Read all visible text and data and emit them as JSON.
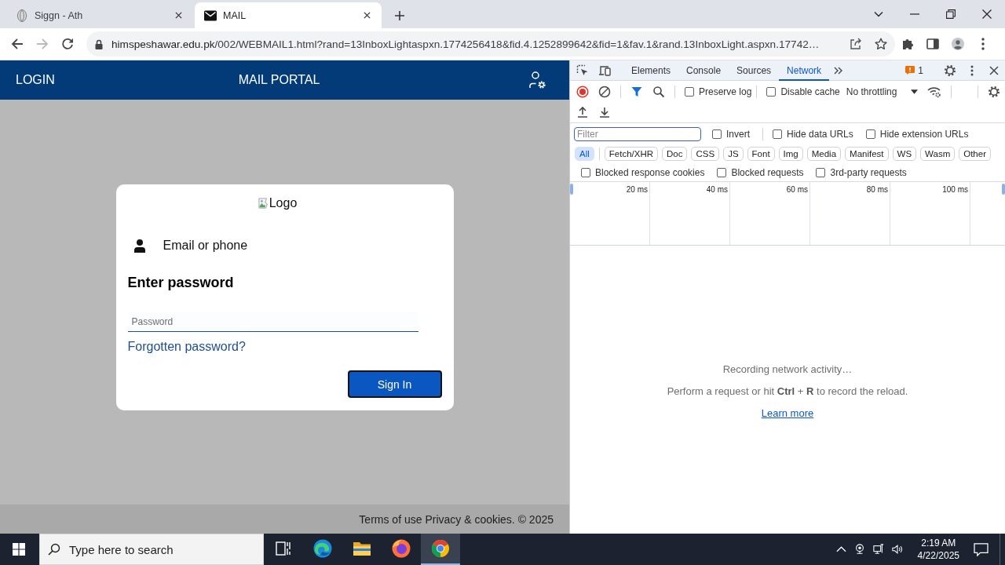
{
  "browser": {
    "tabs": [
      {
        "title": "Siggn - Ath",
        "kind": "globe",
        "selected": false
      },
      {
        "title": "MAIL",
        "kind": "mail",
        "selected": true
      }
    ],
    "nav_buttons": [
      {
        "kind": "back",
        "disabled": false
      },
      {
        "kind": "forward",
        "disabled": true
      },
      {
        "kind": "reload",
        "disabled": false
      }
    ],
    "address": {
      "host": "himspeshawar.edu.pk",
      "path": "/002/WEBMAIL1.html?rand=13InboxLightaspxn.1774256418&fid.4.1252899642&fid=1&fav.1&rand.13InboxLight.aspxn.17742…"
    }
  },
  "page": {
    "header": {
      "left": "LOGIN",
      "title": "MAIL PORTAL"
    },
    "card": {
      "logo_alt": "Logo",
      "account": "Email or phone",
      "heading": "Enter password",
      "password": {
        "placeholder": "Password"
      },
      "forgot_link": "Forgotten password?",
      "submit": "Sign In"
    },
    "footer": "Terms of use Privacy & cookies. © 2025"
  },
  "devtools": {
    "tabs": [
      {
        "label": "Elements",
        "selected": false
      },
      {
        "label": "Console",
        "selected": false
      },
      {
        "label": "Sources",
        "selected": false
      },
      {
        "label": "Network",
        "selected": true
      }
    ],
    "issues_count": "1",
    "recording": true,
    "toolbar_checks": [
      {
        "label": "Preserve log",
        "checked": false
      },
      {
        "label": "Disable cache",
        "checked": false
      }
    ],
    "throttling": "No throttling",
    "filter": {
      "placeholder": "Filter",
      "focused": true
    },
    "filter_checks": [
      {
        "label": "Invert",
        "checked": false
      },
      {
        "label": "Hide data URLs",
        "checked": false
      },
      {
        "label": "Hide extension URLs",
        "checked": false
      }
    ],
    "types": [
      {
        "label": "All",
        "selected": true
      },
      {
        "label": "Fetch/XHR",
        "selected": false
      },
      {
        "label": "Doc",
        "selected": false
      },
      {
        "label": "CSS",
        "selected": false
      },
      {
        "label": "JS",
        "selected": false
      },
      {
        "label": "Font",
        "selected": false
      },
      {
        "label": "Img",
        "selected": false
      },
      {
        "label": "Media",
        "selected": false
      },
      {
        "label": "Manifest",
        "selected": false
      },
      {
        "label": "WS",
        "selected": false
      },
      {
        "label": "Wasm",
        "selected": false
      },
      {
        "label": "Other",
        "selected": false
      }
    ],
    "request_checks": [
      {
        "label": "Blocked response cookies",
        "checked": false
      },
      {
        "label": "Blocked requests",
        "checked": false
      },
      {
        "label": "3rd-party requests",
        "checked": false
      }
    ],
    "timeline_ticks": [
      "20 ms",
      "40 ms",
      "60 ms",
      "80 ms",
      "100 ms"
    ],
    "empty_state": {
      "status": "Recording network activity…",
      "hint": "Perform a request or hit **Ctrl** + **R** to record the reload.",
      "link": "Learn more"
    }
  },
  "taskbar": {
    "search": {
      "placeholder": "Type here to search"
    },
    "apps": [
      {
        "kind": "task-view",
        "selected": false
      },
      {
        "kind": "edge",
        "selected": false
      },
      {
        "kind": "explorer",
        "selected": false
      },
      {
        "kind": "firefox",
        "selected": false
      },
      {
        "kind": "chrome",
        "selected": true
      }
    ],
    "time": "2:19 AM",
    "date": "4/22/2025"
  }
}
